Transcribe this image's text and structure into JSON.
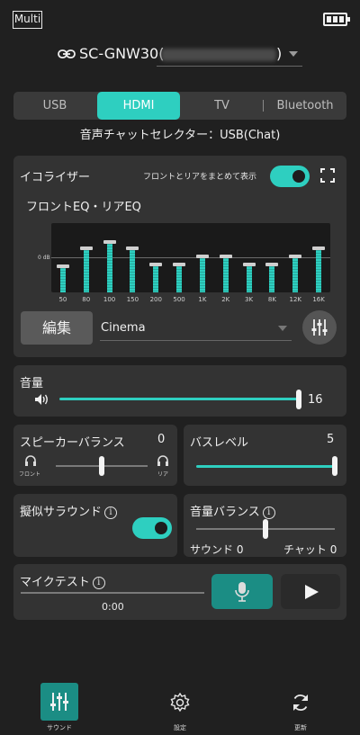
{
  "header": {
    "mode_label": "Multi",
    "device_name": "SC-GNW30(",
    "device_name_suffix": ")"
  },
  "tabs": [
    {
      "label": "USB",
      "selected": false
    },
    {
      "label": "HDMI",
      "selected": true
    },
    {
      "label": "TV",
      "selected": false
    },
    {
      "label": "Bluetooth",
      "selected": false
    }
  ],
  "chat_selector_text": "音声チャットセレクター：USB(Chat)",
  "equalizer": {
    "title": "イコライザー",
    "combine_label": "フロントとリアをまとめて表示",
    "combine_on": true,
    "eq_title": "フロントEQ・リアEQ",
    "zero_label": "0 dB",
    "bands": [
      {
        "label": "50",
        "level": 0.38
      },
      {
        "label": "80",
        "level": 0.63
      },
      {
        "label": "100",
        "level": 0.73
      },
      {
        "label": "150",
        "level": 0.63
      },
      {
        "label": "200",
        "level": 0.4
      },
      {
        "label": "500",
        "level": 0.4
      },
      {
        "label": "1K",
        "level": 0.52
      },
      {
        "label": "2K",
        "level": 0.52
      },
      {
        "label": "3K",
        "level": 0.4
      },
      {
        "label": "8K",
        "level": 0.4
      },
      {
        "label": "12K",
        "level": 0.52
      },
      {
        "label": "16K",
        "level": 0.63
      }
    ],
    "edit_label": "編集",
    "preset_value": "Cinema"
  },
  "volume": {
    "title": "音量",
    "value": "16",
    "level": 1.0
  },
  "speaker_balance": {
    "title": "スピーカーバランス",
    "value": "0",
    "front_label": "フロント",
    "rear_label": "リア",
    "level": 0.5
  },
  "bass_level": {
    "title": "バスレベル",
    "value": "5",
    "level": 1.0
  },
  "virtual_surround": {
    "title": "擬似サラウンド",
    "info_symbol": "i",
    "enabled": true
  },
  "volume_balance": {
    "title": "音量バランス",
    "info_symbol": "i",
    "sound_label": "サウンド 0",
    "chat_label": "チャット 0",
    "level": 0.5
  },
  "mic_test": {
    "title": "マイクテスト",
    "info_symbol": "i",
    "time": "0:00"
  },
  "bottom_nav": [
    {
      "label": "サウンド",
      "icon": "equalizer-icon",
      "active": true
    },
    {
      "label": "設定",
      "icon": "gear-icon",
      "active": false
    },
    {
      "label": "更新",
      "icon": "refresh-icon",
      "active": false
    }
  ],
  "colors": {
    "accent": "#2ecfc0",
    "background": "#202020",
    "card": "#333333"
  }
}
